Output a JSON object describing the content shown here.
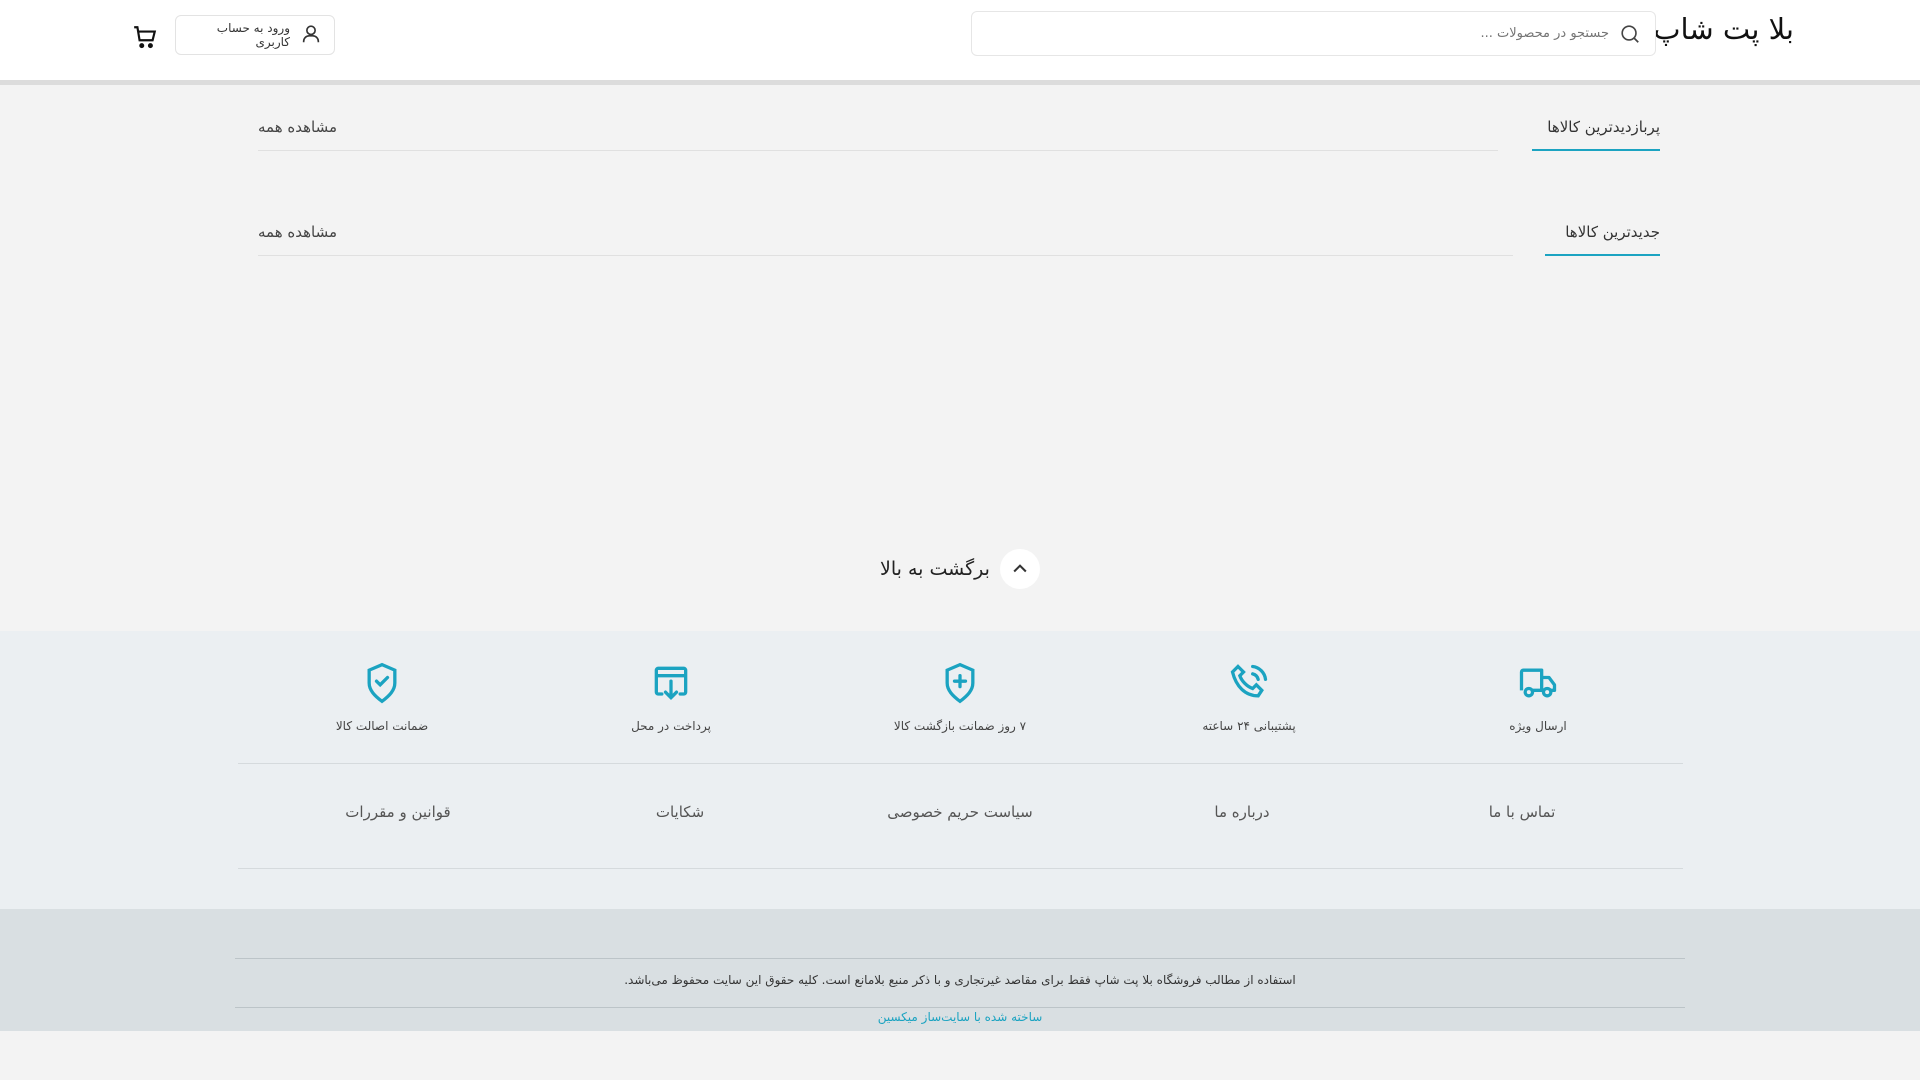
{
  "header": {
    "logo": "بلا پت شاپ",
    "search_placeholder": "جستجو در محصولات ...",
    "login_label": "ورود به حساب کاربری"
  },
  "sections": [
    {
      "title": "پربازدیدترین کالاها",
      "see_all": "مشاهده همه"
    },
    {
      "title": "جدیدترین کالاها",
      "see_all": "مشاهده همه"
    }
  ],
  "back_to_top": "برگشت به بالا",
  "features": [
    "ارسال ویژه",
    "پشتیبانی ۲۴ ساعته",
    "۷ روز ضمانت بازگشت کالا",
    "پرداخت در محل",
    "ضمانت اصالت کالا"
  ],
  "links": [
    "تماس با ما",
    "درباره ما",
    "سیاست حریم خصوصی",
    "شکایات",
    "قوانین و مقررات"
  ],
  "copyright": "استفاده از مطالب فروشگاه بلا پت شاپ فقط برای مقاصد غیرتجاری و با ذکر منبع بلامانع است. کلیه حقوق این سایت محفوظ می‌باشد.",
  "made_with": "ساخته شده با سایت‌ساز میکسین",
  "colors": {
    "accent": "#1ba3c1"
  }
}
